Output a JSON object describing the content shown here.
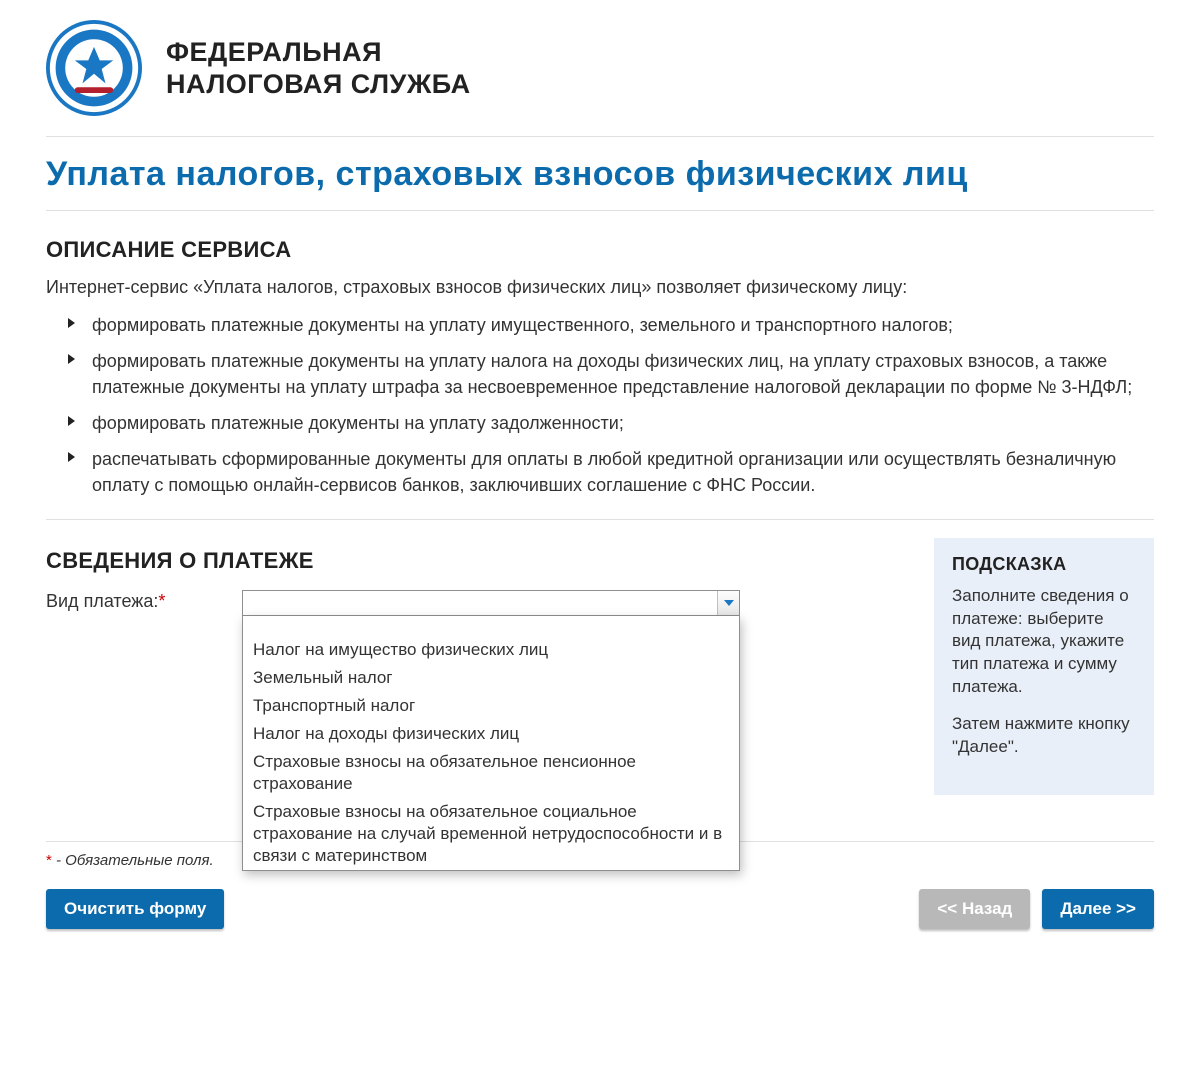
{
  "header": {
    "org_line1": "ФЕДЕРАЛЬНАЯ",
    "org_line2": "НАЛОГОВАЯ СЛУЖБА"
  },
  "page_title": "Уплата налогов, страховых взносов физических лиц",
  "description": {
    "heading": "ОПИСАНИЕ СЕРВИСА",
    "intro": "Интернет-сервис «Уплата налогов, страховых взносов физических лиц» позволяет физическому лицу:",
    "items": [
      "формировать платежные документы на уплату имущественного, земельного и транспортного налогов;",
      "формировать платежные документы на уплату налога на доходы физических лиц, на уплату страховых взносов, а также платежные документы на уплату штрафа за несвоевременное представление налоговой декларации по форме № 3-НДФЛ;",
      "формировать платежные документы на уплату задолженности;",
      "распечатывать сформированные документы для оплаты в любой кредитной организации или осуществлять безналичную оплату с помощью онлайн-сервисов банков, заключивших соглашение с ФНС России."
    ]
  },
  "payment": {
    "heading": "СВЕДЕНИЯ О ПЛАТЕЖЕ",
    "label": "Вид платежа:",
    "input_value": "",
    "options": [
      "Налог на имущество физических лиц",
      "Земельный налог",
      "Транспортный налог",
      "Налог на доходы физических лиц",
      "Страховые взносы на обязательное пенсионное страхование",
      "Страховые взносы на обязательное социальное страхование на случай временной нетрудоспособности и в связи с материнством"
    ]
  },
  "hint": {
    "title": "ПОДСКАЗКА",
    "p1": "Заполните сведения о платеже: выберите вид платежа, укажите тип платежа и сумму платежа.",
    "p2": "Затем нажмите кнопку \"Далее\"."
  },
  "footer": {
    "required_mark": "*",
    "required_text": " - Обязательные поля.",
    "clear": "Очистить форму",
    "back": "<< Назад",
    "next": "Далее >>"
  }
}
